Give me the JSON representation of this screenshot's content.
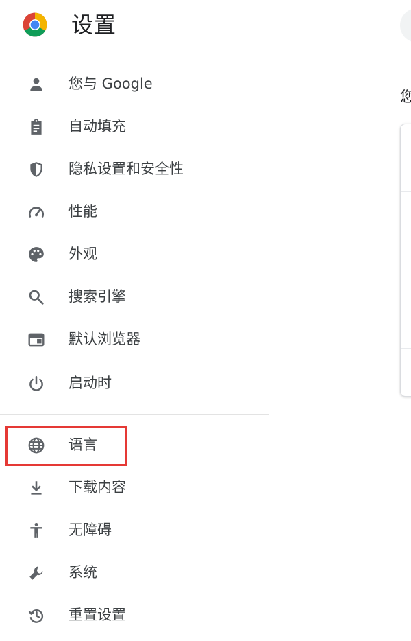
{
  "app": {
    "title": "设置"
  },
  "colors": {
    "highlight": "#e53935",
    "icon": "#5f6368",
    "text": "#3c4043"
  },
  "sidebar": {
    "items": [
      {
        "label": "您与 Google",
        "icon": "person-icon"
      },
      {
        "label": "自动填充",
        "icon": "clipboard-icon"
      },
      {
        "label": "隐私设置和安全性",
        "icon": "shield-icon"
      },
      {
        "label": "性能",
        "icon": "speedometer-icon"
      },
      {
        "label": "外观",
        "icon": "palette-icon"
      },
      {
        "label": "搜索引擎",
        "icon": "search-icon"
      },
      {
        "label": "默认浏览器",
        "icon": "browser-window-icon"
      },
      {
        "label": "启动时",
        "icon": "power-icon"
      },
      {
        "label": "语言",
        "icon": "globe-icon",
        "highlighted": true
      },
      {
        "label": "下载内容",
        "icon": "download-icon"
      },
      {
        "label": "无障碍",
        "icon": "accessibility-icon"
      },
      {
        "label": "系统",
        "icon": "wrench-icon"
      },
      {
        "label": "重置设置",
        "icon": "history-icon"
      }
    ]
  },
  "main": {
    "peek_text": "您"
  }
}
